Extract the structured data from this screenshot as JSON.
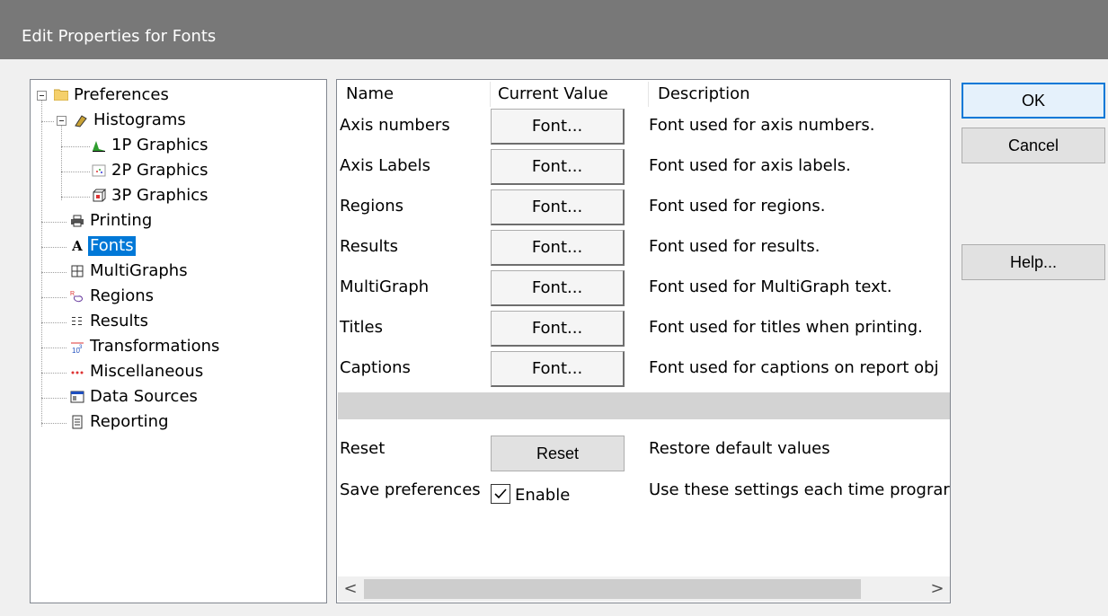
{
  "window": {
    "title": "Edit Properties for Fonts"
  },
  "tree": {
    "root": {
      "label": "Preferences",
      "icon": "folder-icon"
    },
    "histograms": {
      "label": "Histograms",
      "icon": "histogram-icon"
    },
    "children_histograms": [
      {
        "label": "1P Graphics",
        "icon": "1p-graphics-icon"
      },
      {
        "label": "2P Graphics",
        "icon": "2p-graphics-icon"
      },
      {
        "label": "3P Graphics",
        "icon": "3p-graphics-icon"
      }
    ],
    "items": [
      {
        "label": "Printing",
        "icon": "printer-icon"
      },
      {
        "label": "Fonts",
        "icon": "font-icon"
      },
      {
        "label": "MultiGraphs",
        "icon": "multigraph-icon"
      },
      {
        "label": "Regions",
        "icon": "regions-icon"
      },
      {
        "label": "Results",
        "icon": "results-icon"
      },
      {
        "label": "Transformations",
        "icon": "transformations-icon"
      },
      {
        "label": "Miscellaneous",
        "icon": "miscellaneous-icon"
      },
      {
        "label": "Data Sources",
        "icon": "data-sources-icon"
      },
      {
        "label": "Reporting",
        "icon": "reporting-icon"
      }
    ],
    "selected": "Fonts"
  },
  "grid": {
    "headers": {
      "name": "Name",
      "value": "Current Value",
      "description": "Description"
    },
    "rows": [
      {
        "name": "Axis numbers",
        "value": "Font...",
        "description": "Font used for axis numbers."
      },
      {
        "name": "Axis Labels",
        "value": "Font...",
        "description": "Font used for axis labels."
      },
      {
        "name": "Regions",
        "value": "Font...",
        "description": "Font used for regions."
      },
      {
        "name": "Results",
        "value": "Font...",
        "description": "Font used for results."
      },
      {
        "name": "MultiGraph",
        "value": "Font...",
        "description": "Font used for MultiGraph text."
      },
      {
        "name": "Titles",
        "value": "Font...",
        "description": "Font used for titles when printing."
      },
      {
        "name": "Captions",
        "value": "Font...",
        "description": "Font used for captions on report obj"
      }
    ],
    "reset": {
      "name": "Reset",
      "button": "Reset",
      "description": "Restore default values"
    },
    "save": {
      "name": "Save preferences",
      "checkbox_label": "Enable",
      "checked": true,
      "description": "Use these settings each time prograr"
    },
    "scroll": {
      "left": "<",
      "right": ">"
    }
  },
  "buttons": {
    "ok": "OK",
    "cancel": "Cancel",
    "help": "Help..."
  },
  "colors": {
    "titlebar": "#787878",
    "selection": "#0078d7",
    "default_button_border": "#0078d7"
  }
}
